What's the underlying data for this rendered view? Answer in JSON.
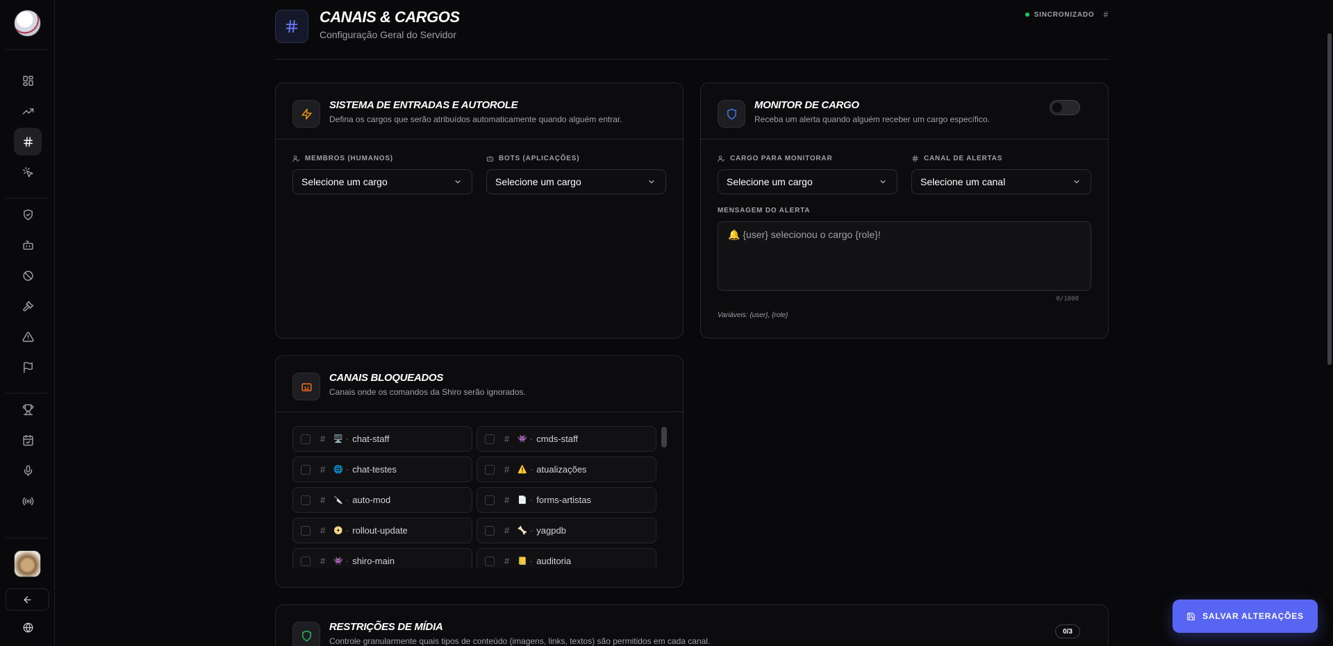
{
  "header": {
    "title": "CANAIS & CARGOS",
    "subtitle": "Configuração Geral do Servidor",
    "sync_status": "SINCRONIZADO",
    "sync_hash": "#"
  },
  "sidebar": {
    "items": [
      {
        "icon": "dashboard-grid-icon"
      },
      {
        "icon": "trending-up-icon"
      },
      {
        "icon": "hash-icon",
        "active": true
      },
      {
        "icon": "sparkle-cursor-icon"
      },
      {
        "icon": "shield-check-icon"
      },
      {
        "icon": "bot-icon"
      },
      {
        "icon": "ban-icon"
      },
      {
        "icon": "gavel-icon"
      },
      {
        "icon": "alert-triangle-icon"
      },
      {
        "icon": "flag-icon"
      },
      {
        "icon": "trophy-icon"
      },
      {
        "icon": "calendar-check-icon"
      },
      {
        "icon": "mic-icon"
      },
      {
        "icon": "broadcast-icon"
      }
    ]
  },
  "autorole": {
    "title": "SISTEMA DE ENTRADAS E AUTOROLE",
    "description": "Defina os cargos que serão atribuídos automaticamente quando alguém entrar.",
    "members_label": "MEMBROS (HUMANOS)",
    "members_value": "Selecione um cargo",
    "bots_label": "BOTS (APLICAÇÕES)",
    "bots_value": "Selecione um cargo"
  },
  "monitor": {
    "title": "MONITOR DE CARGO",
    "description": "Receba um alerta quando alguém receber um cargo específico.",
    "enabled": false,
    "role_label": "CARGO PARA MONITORAR",
    "role_value": "Selecione um cargo",
    "channel_label": "CANAL DE ALERTAS",
    "channel_value": "Selecione um canal",
    "message_label": "MENSAGEM DO ALERTA",
    "message_value": "🔔 {user} selecionou o cargo {role}!",
    "counter": "0/1000",
    "variables": "Variáveis: {user}, {role}"
  },
  "blocked": {
    "title": "CANAIS BLOQUEADOS",
    "description": "Canais onde os comandos da Shiro serão ignorados.",
    "channels": [
      {
        "emoji": "🖥️",
        "name": "chat-staff"
      },
      {
        "emoji": "👾",
        "name": "cmds-staff"
      },
      {
        "emoji": "🌐",
        "name": "chat-testes"
      },
      {
        "emoji": "⚠️",
        "name": "atualizações"
      },
      {
        "emoji": "🔪",
        "name": "auto-mod"
      },
      {
        "emoji": "📄",
        "name": "forms-artistas"
      },
      {
        "emoji": "📀",
        "name": "rollout-update"
      },
      {
        "emoji": "🦴",
        "name": "yagpdb"
      },
      {
        "emoji": "👾",
        "name": "shiro-main"
      },
      {
        "emoji": "📒",
        "name": "auditoria"
      }
    ]
  },
  "media": {
    "title": "RESTRIÇÕES DE MÍDIA",
    "description": "Controle granularmente quais tipos de conteúdo (imagens, links, textos) são permitidos em cada canal.",
    "count": "0/3"
  },
  "save_button": "SALVAR ALTERAÇÕES",
  "colors": {
    "accent": "#5865f2",
    "sync_dot": "#22c55e",
    "autorole_icon": "#f59e0b",
    "monitor_icon": "#3b82f6",
    "blocked_icon": "#f97316",
    "media_icon": "#22c55e"
  }
}
